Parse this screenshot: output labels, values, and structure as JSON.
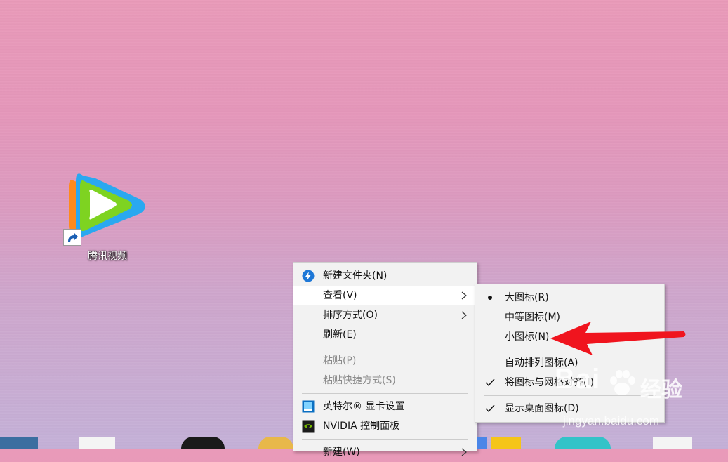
{
  "desktop": {
    "shortcut": {
      "label": "腾讯视频",
      "icon": "tencent-video-icon"
    }
  },
  "context_menu": {
    "items": [
      {
        "label": "新建文件夹(N)",
        "icon": "new-folder-icon",
        "enabled": true
      },
      {
        "label": "查看(V)",
        "submenu": true,
        "hovered": true,
        "enabled": true
      },
      {
        "label": "排序方式(O)",
        "submenu": true,
        "enabled": true
      },
      {
        "label": "刷新(E)",
        "enabled": true
      },
      {
        "label": "粘贴(P)",
        "enabled": false
      },
      {
        "label": "粘贴快捷方式(S)",
        "enabled": false
      },
      {
        "label": "英特尔® 显卡设置",
        "icon": "intel-graphics-icon",
        "enabled": true
      },
      {
        "label": "NVIDIA 控制面板",
        "icon": "nvidia-icon",
        "enabled": true
      },
      {
        "label": "新建(W)",
        "submenu": true,
        "enabled": true
      }
    ]
  },
  "view_submenu": {
    "items": [
      {
        "label": "大图标(R)",
        "state": "selected-radio"
      },
      {
        "label": "中等图标(M)",
        "state": "none"
      },
      {
        "label": "小图标(N)",
        "state": "none"
      },
      {
        "label": "自动排列图标(A)",
        "state": "none"
      },
      {
        "label": "将图标与网格对齐(I)",
        "state": "checked"
      },
      {
        "label": "显示桌面图标(D)",
        "state": "checked"
      }
    ]
  },
  "annotation": {
    "type": "red-arrow",
    "points_to": "小图标(N)",
    "color": "#f0141e"
  },
  "watermark": {
    "brand": "Bai",
    "brand_suffix": "经验",
    "url": "jingyan.baidu.com"
  },
  "colors": {
    "menu_bg": "#f2f2f2",
    "menu_hover": "#ffffff",
    "disabled_text": "#8a8a8a",
    "arrow_red": "#f0141e"
  }
}
